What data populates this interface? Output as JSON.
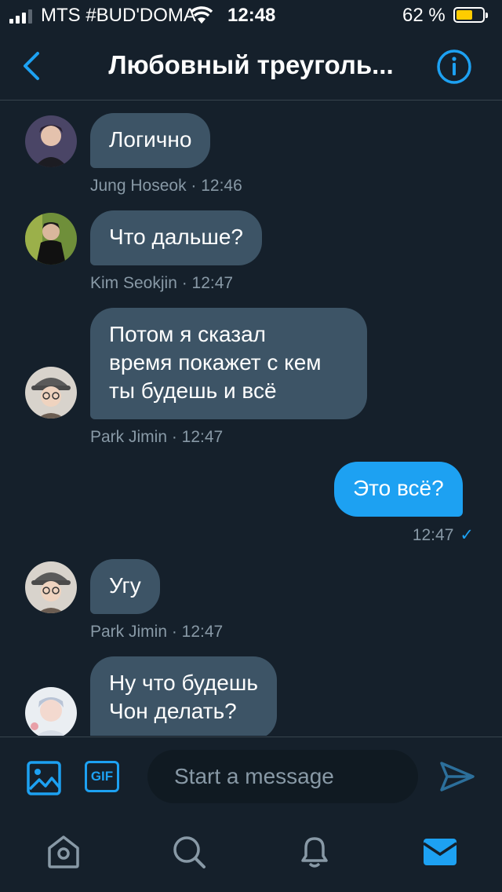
{
  "status_bar": {
    "carrier": "MTS #BUD'DOMA",
    "time": "12:48",
    "battery_percent": "62 %",
    "battery_level": 0.62,
    "signal_bars": 3
  },
  "header": {
    "title": "Любовный треуголь...",
    "back_icon": "chevron-left-icon",
    "info_icon": "info-icon",
    "accent": "#1da1f2"
  },
  "messages": [
    {
      "text": "Логично",
      "meta": "Jung Hoseok · 12:46",
      "from_me": false
    },
    {
      "text": "Что дальше?",
      "meta": "Kim Seokjin · 12:47",
      "from_me": false
    },
    {
      "text": "Потом я сказал\nвремя покажет с кем\nты будешь и всё",
      "meta": "Park Jimin · 12:47",
      "from_me": false
    },
    {
      "text": "Это всё?",
      "meta": "12:47",
      "from_me": true,
      "check": "✓"
    },
    {
      "text": "Угу",
      "meta": "Park Jimin · 12:47",
      "from_me": false
    },
    {
      "text": "Ну что будешь\nЧон делать?",
      "meta": "",
      "from_me": false
    }
  ],
  "composer": {
    "placeholder": "Start a message",
    "gif_label": "GIF",
    "image_icon": "image-icon",
    "send_icon": "send-icon"
  },
  "tabbar": {
    "items": [
      "home-icon",
      "search-icon",
      "bell-icon",
      "mail-icon"
    ],
    "active": "mail-icon"
  },
  "colors": {
    "background": "#15202b",
    "bubble_incoming": "#3d5466",
    "bubble_outgoing": "#1da1f2",
    "meta_text": "#8899a6"
  }
}
